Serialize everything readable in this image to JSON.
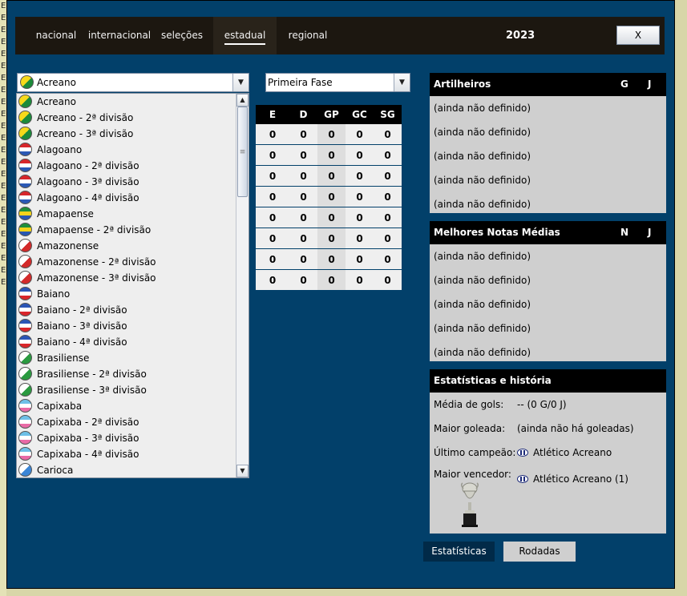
{
  "nav": {
    "tabs": [
      {
        "label": "nacional"
      },
      {
        "label": "internacional"
      },
      {
        "label": "seleções"
      },
      {
        "label": "estadual"
      },
      {
        "label": "regional"
      }
    ],
    "active_tab": "estadual",
    "season": "2023",
    "close_label": "X"
  },
  "state_select": {
    "value": "Acreano",
    "flag_colors": [
      "#f6d91a",
      "#1b8a3a"
    ]
  },
  "phase_select": {
    "value": "Primeira Fase"
  },
  "dropdown": {
    "items": [
      {
        "label": "Acreano",
        "colors": [
          "#f6d91a",
          "#1b8a3a"
        ]
      },
      {
        "label": "Acreano - 2ª divisão",
        "colors": [
          "#f6d91a",
          "#1b8a3a"
        ]
      },
      {
        "label": "Acreano - 3ª divisão",
        "colors": [
          "#f6d91a",
          "#1b8a3a"
        ]
      },
      {
        "label": "Alagoano",
        "colors": [
          "#d7262b",
          "#ffffff",
          "#2b59b5"
        ]
      },
      {
        "label": "Alagoano - 2ª divisão",
        "colors": [
          "#d7262b",
          "#ffffff",
          "#2b59b5"
        ]
      },
      {
        "label": "Alagoano - 3ª divisão",
        "colors": [
          "#d7262b",
          "#ffffff",
          "#2b59b5"
        ]
      },
      {
        "label": "Alagoano - 4ª divisão",
        "colors": [
          "#d7262b",
          "#ffffff",
          "#2b59b5"
        ]
      },
      {
        "label": "Amapaense",
        "colors": [
          "#1f8f3a",
          "#f4d21a",
          "#2857b2"
        ]
      },
      {
        "label": "Amapaense - 2ª divisão",
        "colors": [
          "#1f8f3a",
          "#f4d21a",
          "#2857b2"
        ]
      },
      {
        "label": "Amazonense",
        "colors": [
          "#ffffff",
          "#d32a2a"
        ]
      },
      {
        "label": "Amazonense - 2ª divisão",
        "colors": [
          "#ffffff",
          "#d32a2a"
        ]
      },
      {
        "label": "Amazonense - 3ª divisão",
        "colors": [
          "#ffffff",
          "#d32a2a"
        ]
      },
      {
        "label": "Baiano",
        "colors": [
          "#2a55b6",
          "#ffffff",
          "#d9262b"
        ]
      },
      {
        "label": "Baiano - 2ª divisão",
        "colors": [
          "#2a55b6",
          "#ffffff",
          "#d9262b"
        ]
      },
      {
        "label": "Baiano - 3ª divisão",
        "colors": [
          "#2a55b6",
          "#ffffff",
          "#d9262b"
        ]
      },
      {
        "label": "Baiano - 4ª divisão",
        "colors": [
          "#2a55b6",
          "#ffffff",
          "#d9262b"
        ]
      },
      {
        "label": "Brasiliense",
        "colors": [
          "#ffffff",
          "#2a9a40"
        ]
      },
      {
        "label": "Brasiliense - 2ª divisão",
        "colors": [
          "#ffffff",
          "#2a9a40"
        ]
      },
      {
        "label": "Brasiliense - 3ª divisão",
        "colors": [
          "#ffffff",
          "#2a9a40"
        ]
      },
      {
        "label": "Capixaba",
        "colors": [
          "#6ec0e8",
          "#ffffff",
          "#e96aa6"
        ]
      },
      {
        "label": "Capixaba - 2ª divisão",
        "colors": [
          "#6ec0e8",
          "#ffffff",
          "#e96aa6"
        ]
      },
      {
        "label": "Capixaba - 3ª divisão",
        "colors": [
          "#6ec0e8",
          "#ffffff",
          "#e96aa6"
        ]
      },
      {
        "label": "Capixaba - 4ª divisão",
        "colors": [
          "#6ec0e8",
          "#ffffff",
          "#e96aa6"
        ]
      },
      {
        "label": "Carioca",
        "colors": [
          "#ffffff",
          "#3b86d6"
        ]
      }
    ]
  },
  "standings": {
    "headers": [
      "E",
      "D",
      "GP",
      "GC",
      "SG"
    ],
    "rows": [
      [
        "0",
        "0",
        "0",
        "0",
        "0"
      ],
      [
        "0",
        "0",
        "0",
        "0",
        "0"
      ],
      [
        "0",
        "0",
        "0",
        "0",
        "0"
      ],
      [
        "0",
        "0",
        "0",
        "0",
        "0"
      ],
      [
        "0",
        "0",
        "0",
        "0",
        "0"
      ],
      [
        "0",
        "0",
        "0",
        "0",
        "0"
      ],
      [
        "0",
        "0",
        "0",
        "0",
        "0"
      ],
      [
        "0",
        "0",
        "0",
        "0",
        "0"
      ]
    ]
  },
  "scorers": {
    "title": "Artilheiros",
    "col1": "G",
    "col2": "J",
    "rows": [
      "(ainda não definido)",
      "(ainda não definido)",
      "(ainda não definido)",
      "(ainda não definido)",
      "(ainda não definido)"
    ]
  },
  "ratings": {
    "title": "Melhores Notas Médias",
    "col1": "N",
    "col2": "J",
    "rows": [
      "(ainda não definido)",
      "(ainda não definido)",
      "(ainda não definido)",
      "(ainda não definido)",
      "(ainda não definido)"
    ]
  },
  "stats": {
    "title": "Estatísticas e história",
    "avg_goals_label": "Média de gols:",
    "avg_goals_value": "-- (0 G/0 J)",
    "biggest_win_label": "Maior goleada:",
    "biggest_win_value": "(ainda não há goleadas)",
    "last_champion_label": "Último campeão:",
    "last_champion_value": "Atlético Acreano",
    "top_winner_label": "Maior vencedor:",
    "top_winner_value": "Atlético Acreano (1)"
  },
  "bottom_tabs": {
    "stats_label": "Estatísticas",
    "rounds_label": "Rodadas"
  },
  "colors": {
    "window_bg": "#02406a",
    "nav_bg": "#1c1710",
    "panel_bg": "#cfcfcf"
  }
}
